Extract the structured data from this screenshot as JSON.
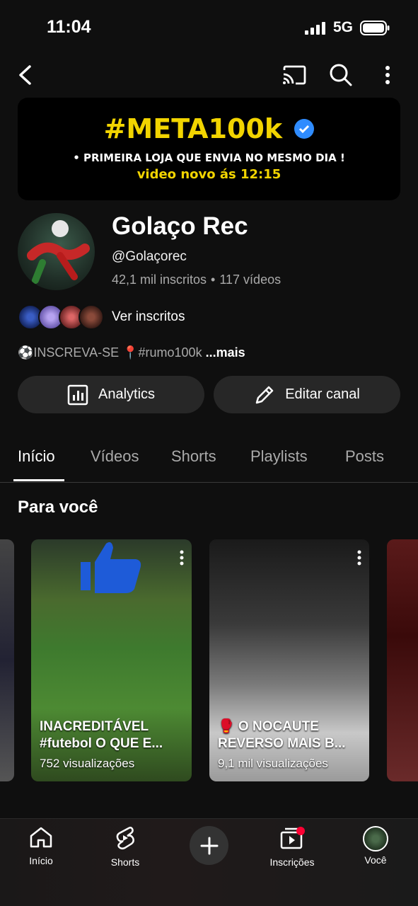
{
  "status_bar": {
    "time": "11:04",
    "network": "5G"
  },
  "banner": {
    "title": "#META100k",
    "line1": "• PRIMEIRA LOJA QUE ENVIA NO MESMO DIA !",
    "line2": "video novo ás 12:15"
  },
  "channel": {
    "name": "Golaço Rec",
    "handle": "@Golaçorec",
    "subscribers": "42,1 mil inscritos",
    "separator": "•",
    "videos": "117 vídeos",
    "subs_link": "Ver inscritos",
    "description": "⚽INSCREVA-SE 📍#rumo100k",
    "description_more": "...mais"
  },
  "actions": {
    "analytics": "Analytics",
    "edit": "Editar canal"
  },
  "tabs": [
    {
      "label": "Início",
      "active": true
    },
    {
      "label": "Vídeos",
      "active": false
    },
    {
      "label": "Shorts",
      "active": false
    },
    {
      "label": "Playlists",
      "active": false
    },
    {
      "label": "Posts",
      "active": false
    }
  ],
  "section": {
    "title": "Para você"
  },
  "cards": [
    {
      "title": "INACREDITÁVEL #futebol  O QUE E...",
      "views": "752 visualizações"
    },
    {
      "title": "🥊 O NOCAUTE REVERSO MAIS B...",
      "views": "9,1 mil visualizações"
    }
  ],
  "bottom_nav": [
    {
      "label": "Início",
      "icon": "home-icon"
    },
    {
      "label": "Shorts",
      "icon": "shorts-icon"
    },
    {
      "label": "",
      "icon": "plus-icon"
    },
    {
      "label": "Inscrições",
      "icon": "subscriptions-icon"
    },
    {
      "label": "Você",
      "icon": "avatar"
    }
  ],
  "colors": {
    "background": "#0f0f0f",
    "button": "#272727",
    "banner_accent": "#f2d400",
    "verified": "#2f8cff",
    "notification": "#ff0033"
  }
}
